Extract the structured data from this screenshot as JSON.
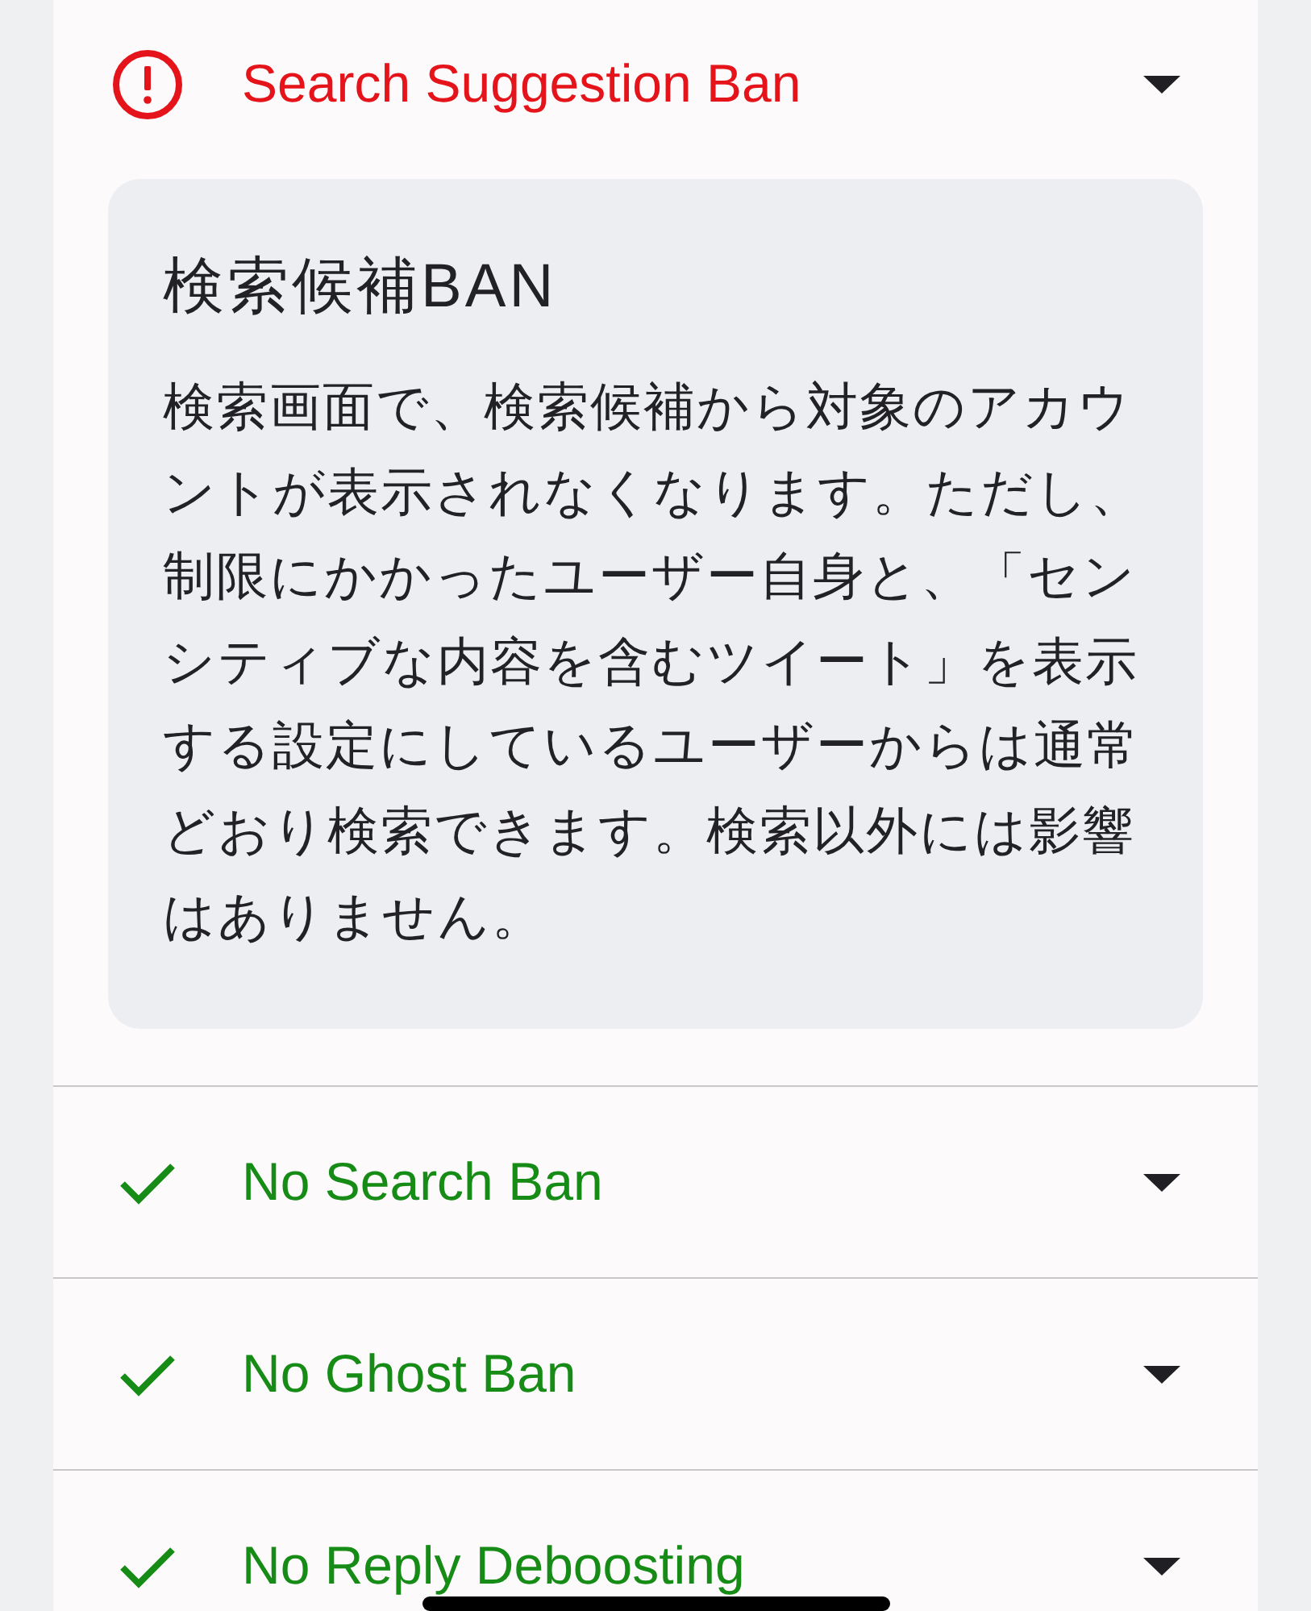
{
  "results": [
    {
      "kind": "warning",
      "title": "Search Suggestion Ban",
      "expanded": true,
      "detail": {
        "heading": "検索候補BAN",
        "body": "検索画面で、検索候補から対象のアカウントが表示されなくなります。ただし、制限にかかったユーザー自身と、「センシティブな内容を含むツイート」を表示する設定にしているユーザーからは通常どおり検索できます。検索以外には影響はありません。"
      }
    },
    {
      "kind": "ok",
      "title": "No Search Ban",
      "expanded": false
    },
    {
      "kind": "ok",
      "title": "No Ghost Ban",
      "expanded": false
    },
    {
      "kind": "ok",
      "title": "No Reply Deboosting",
      "expanded": false
    }
  ]
}
